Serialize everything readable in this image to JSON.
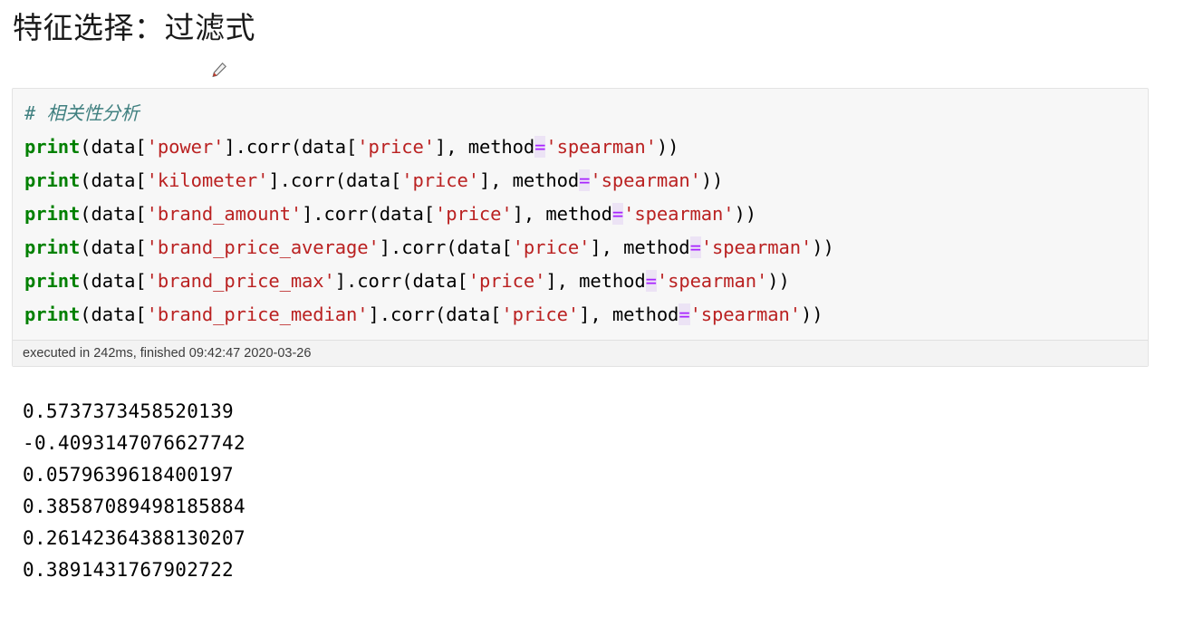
{
  "page_title": "特征选择：过滤式",
  "cursor": {
    "icon": "pen-cursor-icon"
  },
  "cell": {
    "code_lines": [
      {
        "id": "code-line-1",
        "tokens": [
          {
            "type": "comment",
            "text": "# 相关性分析"
          }
        ]
      },
      {
        "id": "code-line-2",
        "tokens": [
          {
            "type": "fn",
            "text": "print"
          },
          {
            "type": "plain",
            "text": "(data["
          },
          {
            "type": "str",
            "text": "'power'"
          },
          {
            "type": "plain",
            "text": "].corr(data["
          },
          {
            "type": "str",
            "text": "'price'"
          },
          {
            "type": "plain",
            "text": "], method"
          },
          {
            "type": "op",
            "text": "="
          },
          {
            "type": "str",
            "text": "'spearman'"
          },
          {
            "type": "plain",
            "text": "))"
          }
        ]
      },
      {
        "id": "code-line-3",
        "tokens": [
          {
            "type": "fn",
            "text": "print"
          },
          {
            "type": "plain",
            "text": "(data["
          },
          {
            "type": "str",
            "text": "'kilometer'"
          },
          {
            "type": "plain",
            "text": "].corr(data["
          },
          {
            "type": "str",
            "text": "'price'"
          },
          {
            "type": "plain",
            "text": "], method"
          },
          {
            "type": "op",
            "text": "="
          },
          {
            "type": "str",
            "text": "'spearman'"
          },
          {
            "type": "plain",
            "text": "))"
          }
        ]
      },
      {
        "id": "code-line-4",
        "tokens": [
          {
            "type": "fn",
            "text": "print"
          },
          {
            "type": "plain",
            "text": "(data["
          },
          {
            "type": "str",
            "text": "'brand_amount'"
          },
          {
            "type": "plain",
            "text": "].corr(data["
          },
          {
            "type": "str",
            "text": "'price'"
          },
          {
            "type": "plain",
            "text": "], method"
          },
          {
            "type": "op",
            "text": "="
          },
          {
            "type": "str",
            "text": "'spearman'"
          },
          {
            "type": "plain",
            "text": "))"
          }
        ]
      },
      {
        "id": "code-line-5",
        "tokens": [
          {
            "type": "fn",
            "text": "print"
          },
          {
            "type": "plain",
            "text": "(data["
          },
          {
            "type": "str",
            "text": "'brand_price_average'"
          },
          {
            "type": "plain",
            "text": "].corr(data["
          },
          {
            "type": "str",
            "text": "'price'"
          },
          {
            "type": "plain",
            "text": "], method"
          },
          {
            "type": "op",
            "text": "="
          },
          {
            "type": "str",
            "text": "'spearman'"
          },
          {
            "type": "plain",
            "text": "))"
          }
        ]
      },
      {
        "id": "code-line-6",
        "tokens": [
          {
            "type": "fn",
            "text": "print"
          },
          {
            "type": "plain",
            "text": "(data["
          },
          {
            "type": "str",
            "text": "'brand_price_max'"
          },
          {
            "type": "plain",
            "text": "].corr(data["
          },
          {
            "type": "str",
            "text": "'price'"
          },
          {
            "type": "plain",
            "text": "], method"
          },
          {
            "type": "op",
            "text": "="
          },
          {
            "type": "str",
            "text": "'spearman'"
          },
          {
            "type": "plain",
            "text": "))"
          }
        ]
      },
      {
        "id": "code-line-7",
        "tokens": [
          {
            "type": "fn",
            "text": "print"
          },
          {
            "type": "plain",
            "text": "(data["
          },
          {
            "type": "str",
            "text": "'brand_price_median'"
          },
          {
            "type": "plain",
            "text": "].corr(data["
          },
          {
            "type": "str",
            "text": "'price'"
          },
          {
            "type": "plain",
            "text": "], method"
          },
          {
            "type": "op",
            "text": "="
          },
          {
            "type": "str",
            "text": "'spearman'"
          },
          {
            "type": "plain",
            "text": "))"
          }
        ]
      }
    ],
    "exec_status": "executed in 242ms, finished 09:42:47 2020-03-26"
  },
  "output_lines": [
    "0.5737373458520139",
    "-0.4093147076627742",
    "0.0579639618400197",
    "0.38587089498185884",
    "0.26142364388130207",
    "0.3891431767902722"
  ],
  "colors": {
    "comment": "#408080",
    "function": "#008000",
    "string": "#ba2121",
    "operator": "#a722ff",
    "operator_bg": "#ece3f5",
    "cell_bg": "#f7f7f7",
    "cell_border": "#e3e3e3",
    "exec_bar_bg": "#f3f3f3"
  }
}
